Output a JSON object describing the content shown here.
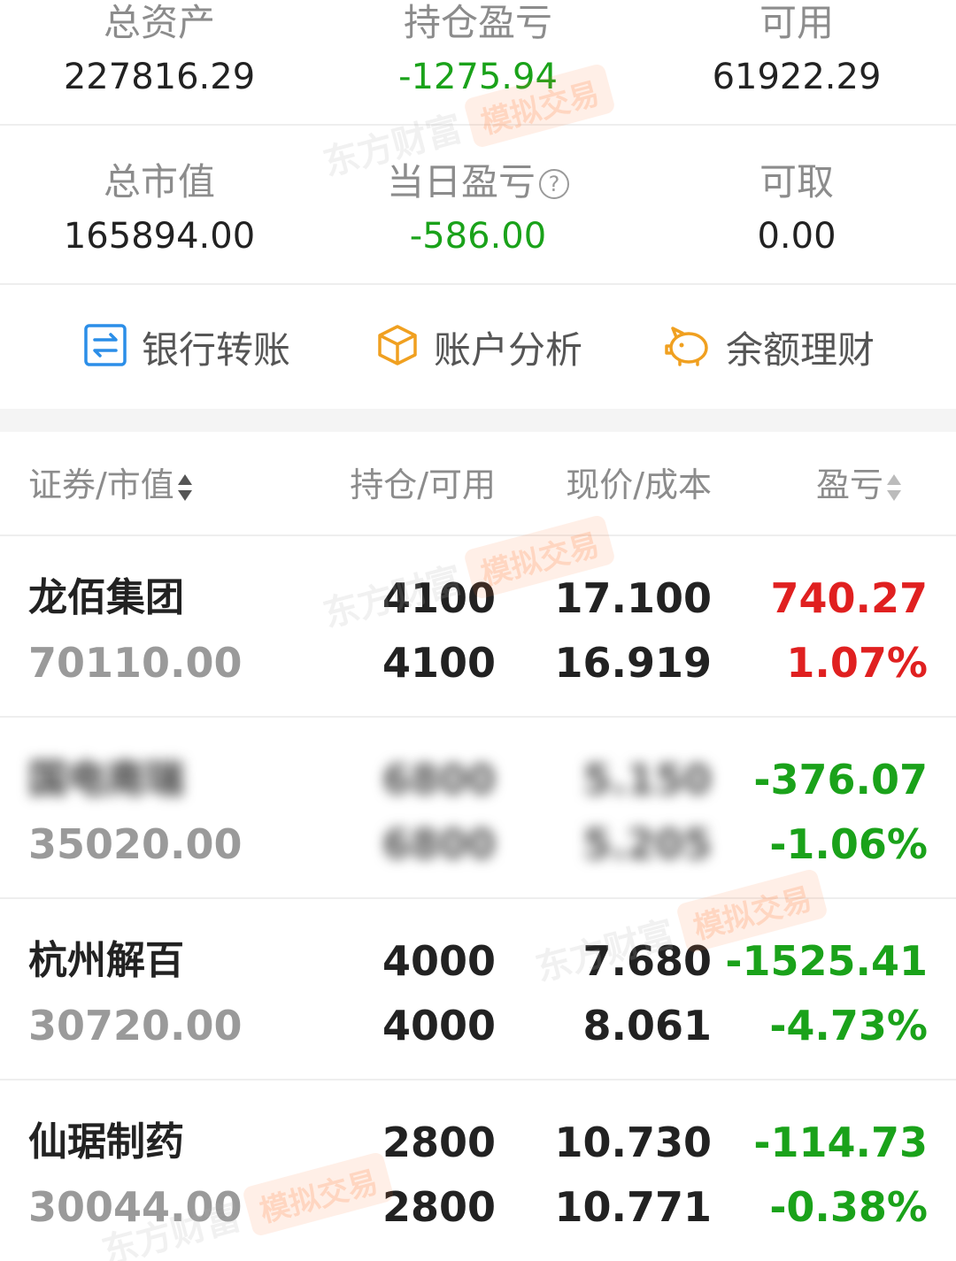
{
  "summary": [
    {
      "label": "总资产",
      "value": "227816.29",
      "status": "neutral"
    },
    {
      "label": "持仓盈亏",
      "value": "-1275.94",
      "status": "loss"
    },
    {
      "label": "可用",
      "value": "61922.29",
      "status": "neutral"
    },
    {
      "label": "总市值",
      "value": "165894.00",
      "status": "neutral"
    },
    {
      "label": "当日盈亏",
      "value": "-586.00",
      "status": "loss",
      "help_icon": "?"
    },
    {
      "label": "可取",
      "value": "0.00",
      "status": "neutral"
    }
  ],
  "actions": [
    {
      "label": "银行转账",
      "icon": "transfer-icon",
      "color": "#2b8ee8"
    },
    {
      "label": "账户分析",
      "icon": "cube-icon",
      "color": "#f0a020"
    },
    {
      "label": "余额理财",
      "icon": "piggy-bank-icon",
      "color": "#f0a020"
    }
  ],
  "table": {
    "headers": [
      "证券/市值",
      "持仓/可用",
      "现价/成本",
      "盈亏"
    ],
    "rows": [
      {
        "name": "龙佰集团",
        "market_value": "70110.00",
        "position": "4100",
        "available": "4100",
        "price": "17.100",
        "cost": "16.919",
        "pl": "740.27",
        "pl_pct": "1.07%",
        "status": "gain",
        "blurred": false
      },
      {
        "name": "国电南瑞",
        "market_value": "35020.00",
        "position": "6800",
        "available": "6800",
        "price": "5.150",
        "cost": "5.205",
        "pl": "-376.07",
        "pl_pct": "-1.06%",
        "status": "loss",
        "blurred": true
      },
      {
        "name": "杭州解百",
        "market_value": "30720.00",
        "position": "4000",
        "available": "4000",
        "price": "7.680",
        "cost": "8.061",
        "pl": "-1525.41",
        "pl_pct": "-4.73%",
        "status": "loss",
        "blurred": false
      },
      {
        "name": "仙琚制药",
        "market_value": "30044.00",
        "position": "2800",
        "available": "2800",
        "price": "10.730",
        "cost": "10.771",
        "pl": "-114.73",
        "pl_pct": "-0.38%",
        "status": "loss",
        "blurred": false
      }
    ]
  },
  "watermark": {
    "brand": "东方财富",
    "tag": "模拟交易"
  },
  "colors": {
    "gain": "#e02020",
    "loss": "#1aa21a",
    "label": "#8c8c8c"
  }
}
